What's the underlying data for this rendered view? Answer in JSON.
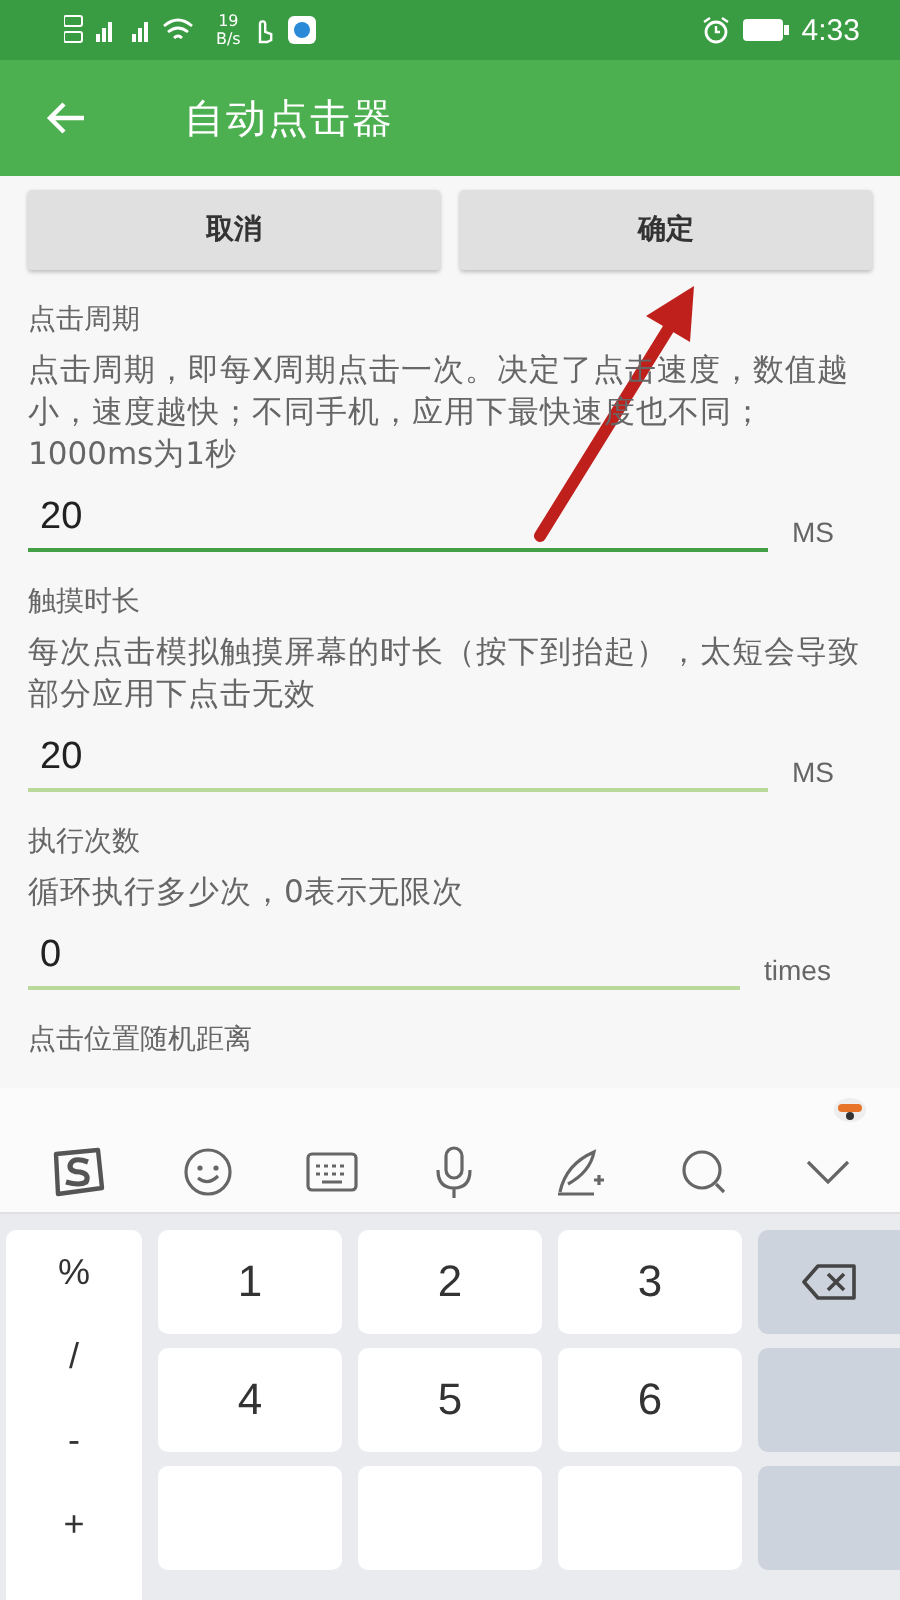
{
  "status_bar": {
    "speed": "19",
    "speed_unit": "B/s",
    "time": "4:33"
  },
  "app_bar": {
    "title": "自动点击器"
  },
  "buttons": [
    {
      "label": "取消"
    },
    {
      "label": "确定"
    }
  ],
  "settings": [
    {
      "label": "点击周期",
      "description": "点击周期，即每X周期点击一次。决定了点击速度，数值越小，速度越快；不同手机，应用下最快速度也不同；1000ms为1秒",
      "value": "20",
      "unit": "MS",
      "focused": true
    },
    {
      "label": "触摸时长",
      "description": "每次点击模拟触摸屏幕的时长（按下到抬起），太短会导致部分应用下点击无效",
      "value": "20",
      "unit": "MS",
      "focused": false
    },
    {
      "label": "执行次数",
      "description": "循环执行多少次，0表示无限次",
      "value": "0",
      "unit": "times",
      "focused": false
    },
    {
      "label": "点击位置随机距离"
    }
  ],
  "keyboard": {
    "symbols": [
      "%",
      "/",
      "-",
      "+"
    ],
    "keys": [
      {
        "kind": "digit",
        "label": "1"
      },
      {
        "kind": "digit",
        "label": "2"
      },
      {
        "kind": "digit",
        "label": "3"
      },
      {
        "kind": "backspace"
      },
      {
        "kind": "digit",
        "label": "4"
      },
      {
        "kind": "digit",
        "label": "5"
      },
      {
        "kind": "digit",
        "label": "6"
      },
      {
        "kind": "blank"
      },
      {
        "kind": "blank"
      },
      {
        "kind": "blank"
      },
      {
        "kind": "blank"
      },
      {
        "kind": "blank"
      }
    ]
  }
}
